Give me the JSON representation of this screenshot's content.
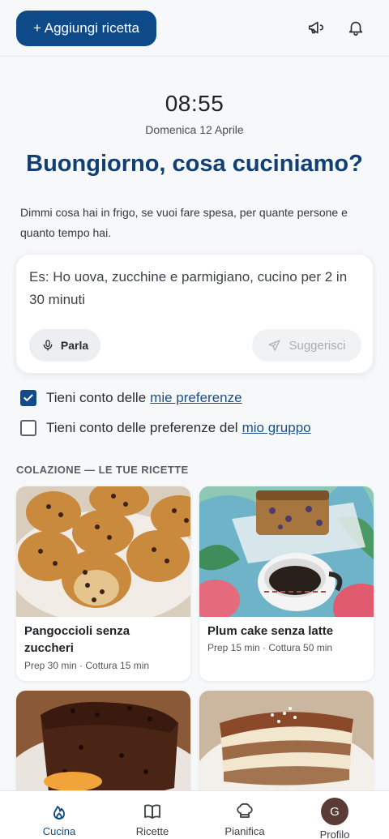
{
  "header": {
    "add_recipe_label": "+ Aggiungi ricetta",
    "icons": [
      "megaphone-icon",
      "bell-icon"
    ]
  },
  "hero": {
    "time": "08:55",
    "date": "Domenica 12 Aprile",
    "greeting": "Buongiorno, cosa cuciniamo?",
    "intro": "Dimmi cosa hai in frigo, se vuoi fare spesa, per quante persone e quanto tempo hai."
  },
  "prompt": {
    "placeholder": "Es: Ho uova, zucchine e parmigiano, cucino per 2 in 30 minuti",
    "speak_label": "Parla",
    "suggest_label": "Suggerisci"
  },
  "preferences": {
    "mine": {
      "text": "Tieni conto delle",
      "link": "mie preferenze",
      "checked": true
    },
    "group": {
      "text": "Tieni conto delle preferenze del",
      "link": "mio gruppo",
      "checked": false
    }
  },
  "section": {
    "title": "COLAZIONE — LE TUE RICETTE"
  },
  "recipes": [
    {
      "title": "Pangoccioli senza zuccheri",
      "meta": "Prep 30 min · Cottura 15 min"
    },
    {
      "title": "Plum cake senza latte",
      "meta": "Prep 15 min · Cottura 50 min"
    },
    {
      "title": "",
      "meta": ""
    },
    {
      "title": "",
      "meta": ""
    }
  ],
  "nav": {
    "items": [
      {
        "label": "Cucina",
        "icon": "flame-icon",
        "active": true
      },
      {
        "label": "Ricette",
        "icon": "book-icon",
        "active": false
      },
      {
        "label": "Pianifica",
        "icon": "chef-hat-icon",
        "active": false
      },
      {
        "label": "Profilo",
        "icon": "avatar",
        "avatar_letter": "G",
        "active": false
      }
    ]
  },
  "colors": {
    "primary": "#0e4a87",
    "heading": "#123f73",
    "background": "#f7f8fa"
  }
}
